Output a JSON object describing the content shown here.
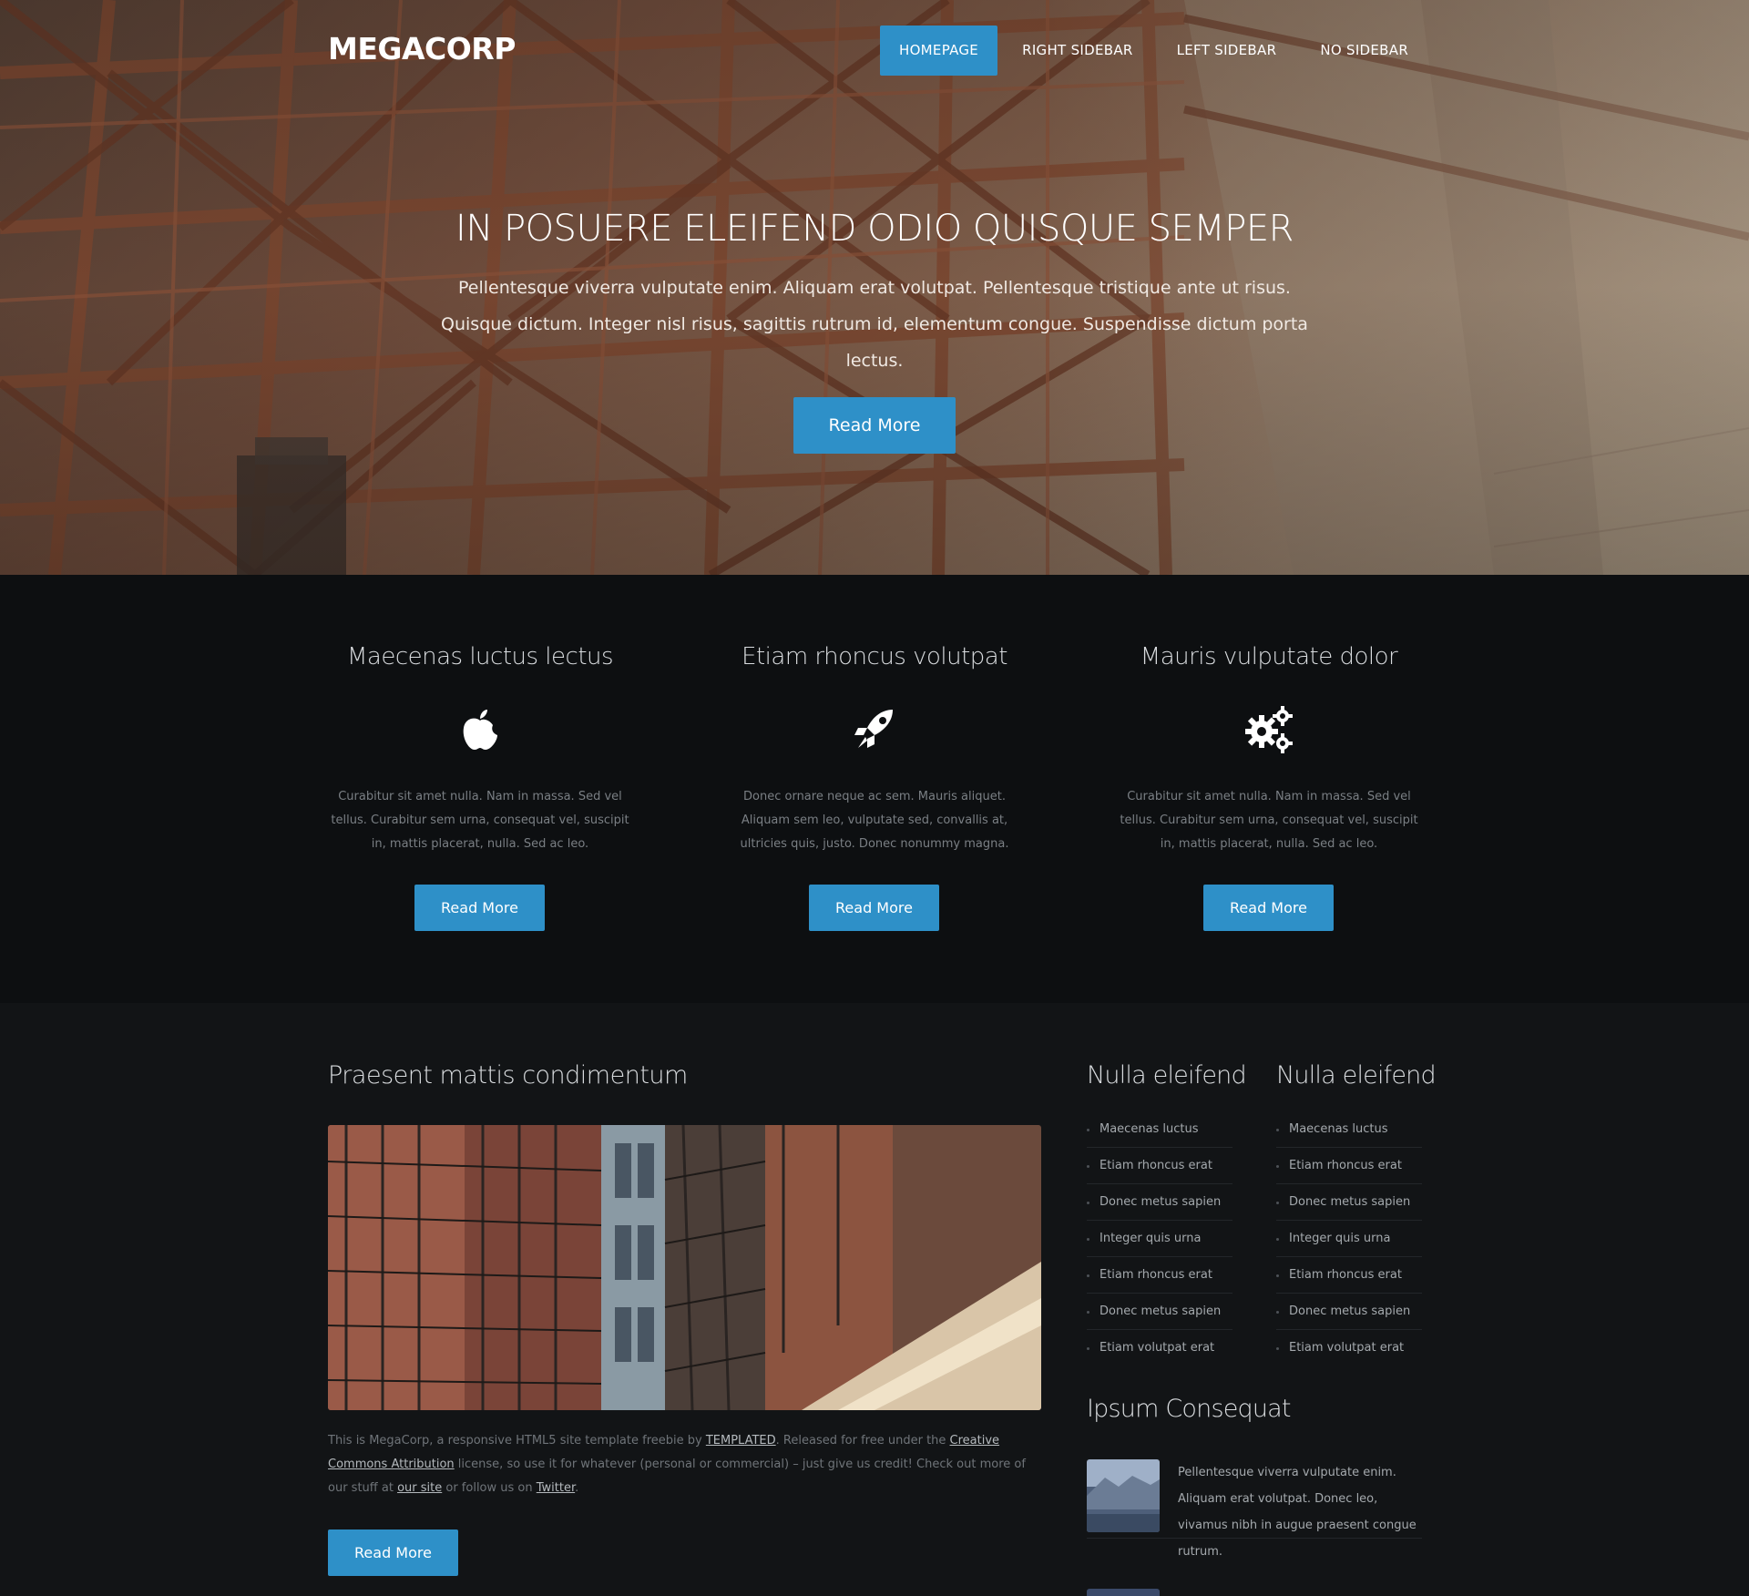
{
  "header": {
    "logo": "MEGACORP",
    "nav": [
      "HOMEPAGE",
      "RIGHT SIDEBAR",
      "LEFT SIDEBAR",
      "NO SIDEBAR"
    ]
  },
  "hero": {
    "title": "IN POSUERE ELEIFEND ODIO QUISQUE SEMPER",
    "text": "Pellentesque viverra vulputate enim. Aliquam erat volutpat. Pellentesque tristique ante ut risus. Quisque dictum. Integer nisl risus, sagittis rutrum id, elementum congue. Suspendisse dictum porta lectus.",
    "button": "Read More"
  },
  "features": [
    {
      "title": "Maecenas luctus lectus",
      "icon": "apple-icon",
      "text": "Curabitur sit amet nulla. Nam in massa. Sed vel tellus. Curabitur sem urna, consequat vel, suscipit in, mattis placerat, nulla. Sed ac leo.",
      "button": "Read More"
    },
    {
      "title": "Etiam rhoncus volutpat",
      "icon": "rocket-icon",
      "text": "Donec ornare neque ac sem. Mauris aliquet. Aliquam sem leo, vulputate sed, convallis at, ultricies quis, justo. Donec nonummy magna.",
      "button": "Read More"
    },
    {
      "title": "Mauris vulputate dolor",
      "icon": "gears-icon",
      "text": "Curabitur sit amet nulla. Nam in massa. Sed vel tellus. Curabitur sem urna, consequat vel, suscipit in, mattis placerat, nulla. Sed ac leo.",
      "button": "Read More"
    }
  ],
  "article": {
    "title": "Praesent mattis condimentum",
    "text_1": "This is MegaCorp, a responsive HTML5 site template freebie by ",
    "link_templated": "TEMPLATED",
    "text_2": ". Released for free under the ",
    "link_cc": "Creative Commons Attribution",
    "text_3": " license, so use it for whatever (personal or commercial) – just give us credit! Check out more of our stuff at ",
    "link_site": "our site",
    "text_4": " or follow us on ",
    "link_twitter": "Twitter",
    "text_5": ".",
    "button": "Read More"
  },
  "sidebar": {
    "col1": {
      "title": "Nulla eleifend",
      "items": [
        "Maecenas luctus",
        "Etiam rhoncus erat",
        "Donec metus sapien",
        "Integer quis urna",
        "Etiam rhoncus erat",
        "Donec metus sapien",
        "Etiam volutpat erat"
      ]
    },
    "col2": {
      "title": "Nulla eleifend",
      "items": [
        "Maecenas luctus",
        "Etiam rhoncus erat",
        "Donec metus sapien",
        "Integer quis urna",
        "Etiam rhoncus erat",
        "Donec metus sapien",
        "Etiam volutpat erat"
      ]
    },
    "ipsum": {
      "title": "Ipsum Consequat",
      "item_text": "Pellentesque viverra vulputate enim. Aliquam erat volutpat. Donec leo, vivamus nibh in augue praesent congue rutrum."
    }
  },
  "colors": {
    "accent": "#2e90c8",
    "background": "#121416",
    "features_bg": "#0d0f11"
  }
}
